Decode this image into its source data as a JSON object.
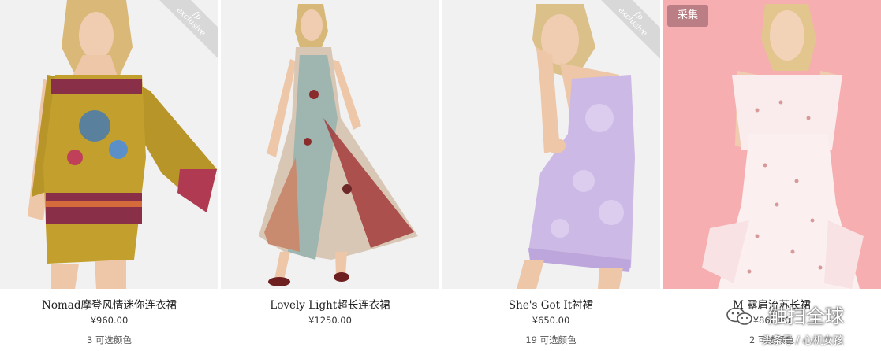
{
  "products": [
    {
      "name": "Nomad摩登风情迷你连衣裙",
      "price": "¥960.00",
      "colors": "3 可选颜色",
      "badge_line1": "fp",
      "badge_line2": "exclusive"
    },
    {
      "name": "Lovely Light超长连衣裙",
      "price": "¥1250.00",
      "colors": ""
    },
    {
      "name": "She's Got It衬裙",
      "price": "¥650.00",
      "colors": "19 可选颜色",
      "badge_line1": "fp",
      "badge_line2": "exclusive"
    },
    {
      "name": "M  露肩流苏长裙",
      "price": "¥866.00",
      "colors": "2 可选颜色",
      "collect_label": "采集"
    }
  ],
  "watermark": {
    "main": "触扫全球",
    "sub": "头条号 / 心机女孩",
    "icon": "wechat-icon"
  },
  "colors": {
    "photo_bg": "#f1f1f1",
    "pink_bg": "#f6aeb1",
    "collect_button": "#b0767c"
  }
}
